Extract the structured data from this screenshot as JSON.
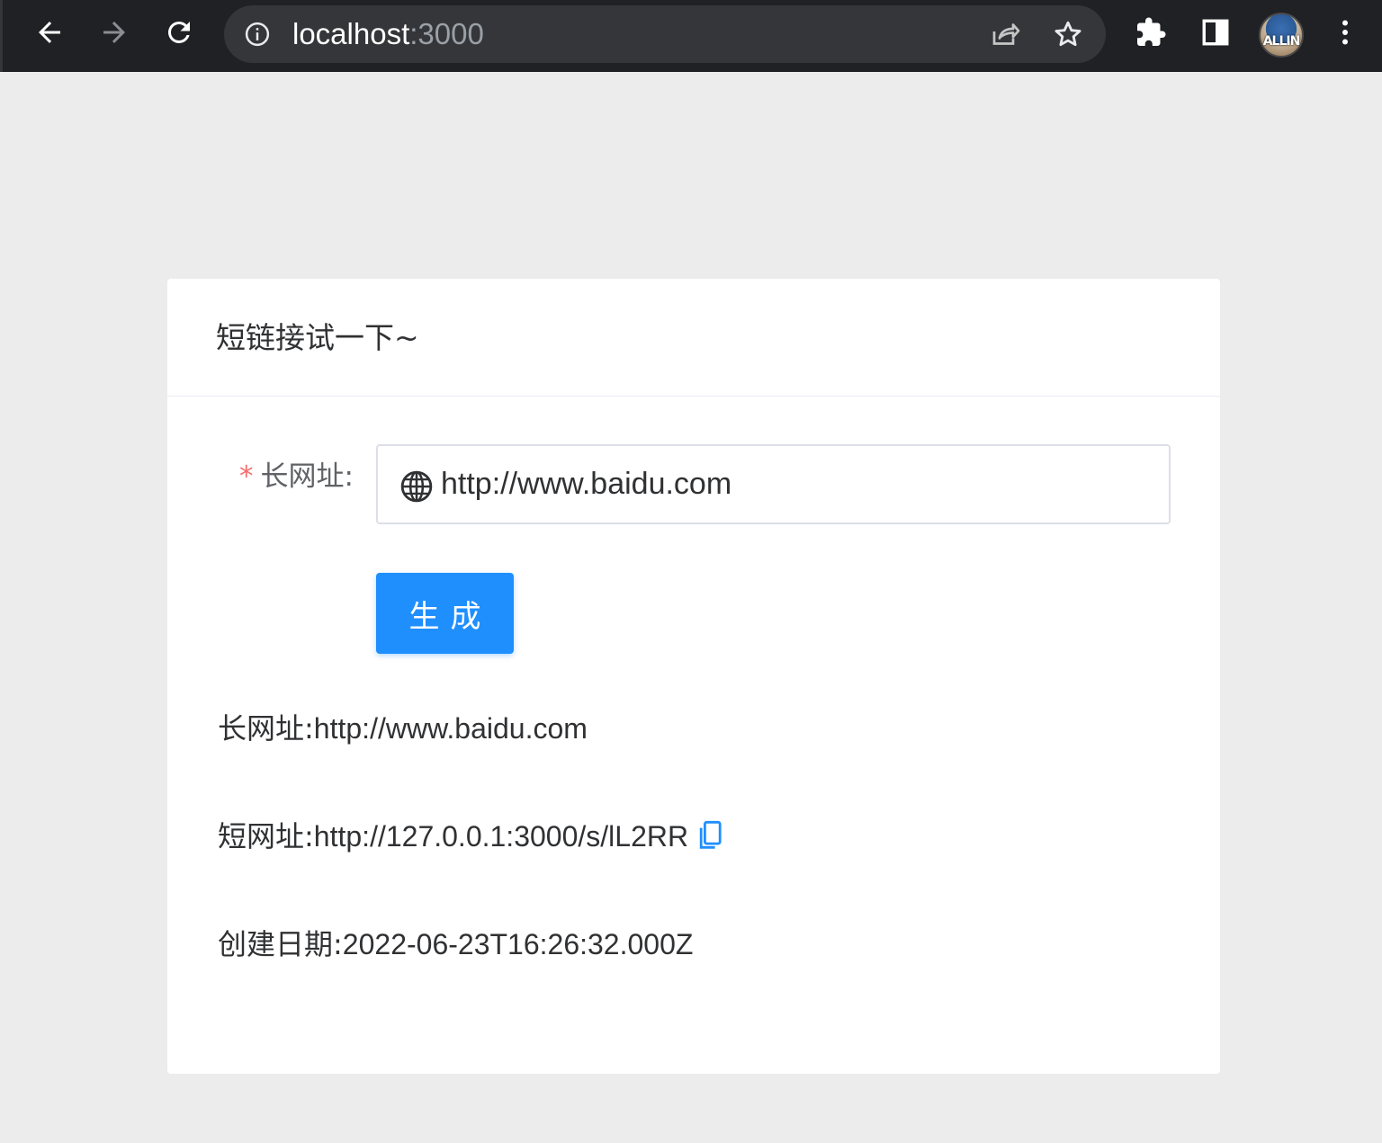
{
  "browser": {
    "url_host": "localhost",
    "url_port": ":3000",
    "avatar_text": "ALLIN",
    "icons": [
      "back-arrow-icon",
      "forward-arrow-icon",
      "reload-icon",
      "info-icon",
      "share-icon",
      "star-icon",
      "extensions-puzzle-icon",
      "side-panel-icon",
      "kebab-menu-icon"
    ]
  },
  "card": {
    "title": "短链接试一下~",
    "form": {
      "required_mark": "*",
      "label": "长网址:",
      "input_value": "http://www.baidu.com",
      "button_label": "生成"
    },
    "result": {
      "long_label": "长网址:",
      "long_value": "http://www.baidu.com",
      "short_label": "短网址:",
      "short_value": "http://127.0.0.1:3000/s/lL2RR",
      "date_label": "创建日期:",
      "date_value": "2022-06-23T16:26:32.000Z"
    }
  },
  "colors": {
    "primary": "#1f8ffe",
    "required": "#f56c6c",
    "page_bg": "#ececec",
    "chrome_bg": "#202124"
  }
}
